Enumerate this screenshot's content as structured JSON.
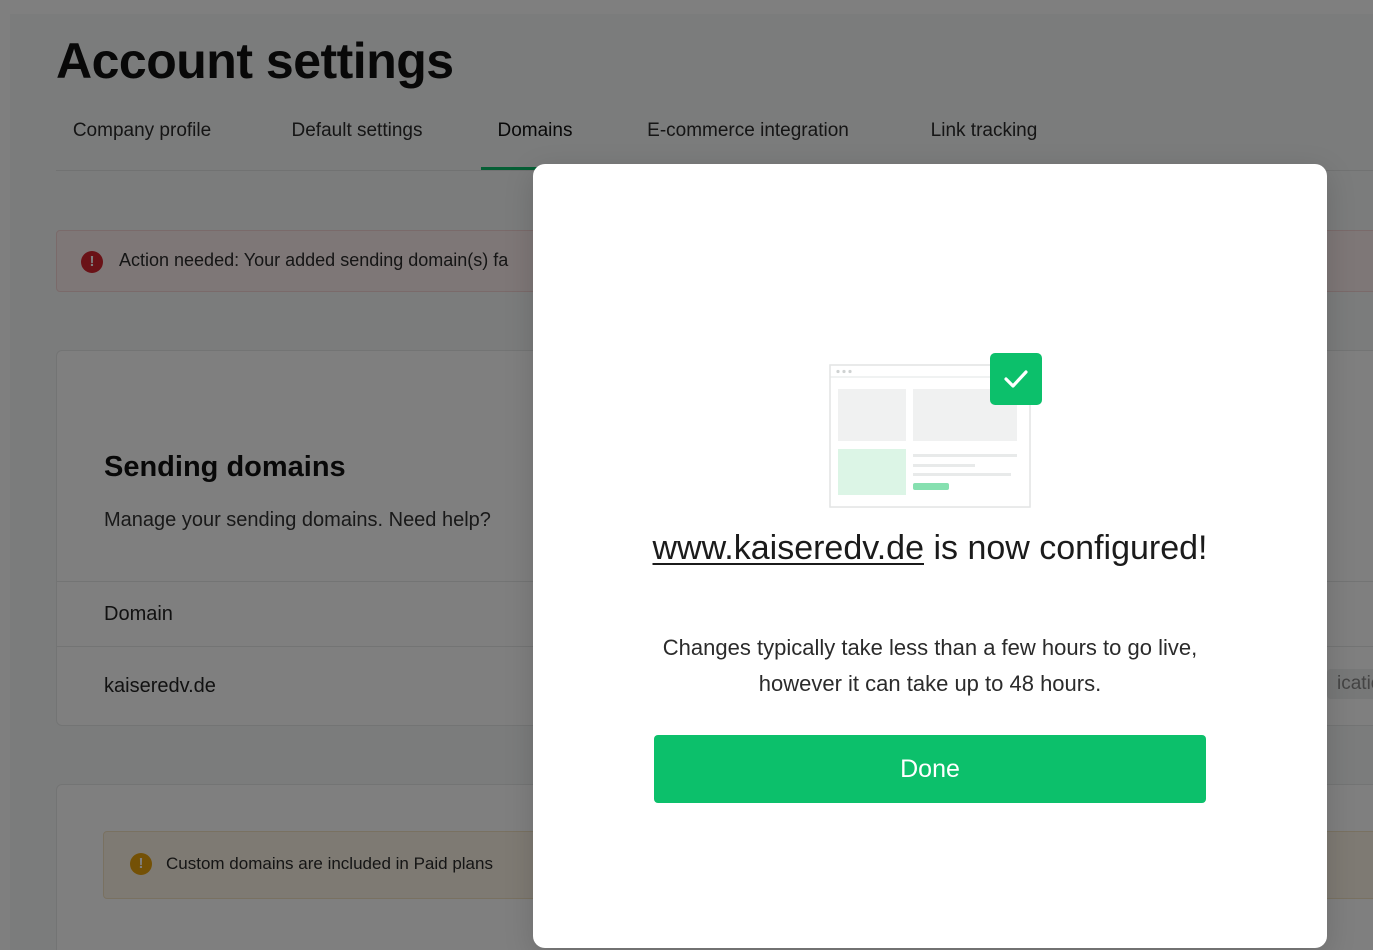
{
  "page": {
    "title": "Account settings",
    "tabs": [
      {
        "label": "Company profile"
      },
      {
        "label": "Default settings"
      },
      {
        "label": "Domains"
      },
      {
        "label": "E-commerce integration"
      },
      {
        "label": "Link tracking"
      }
    ],
    "active_tab": "Domains"
  },
  "alert_error": {
    "icon": "exclamation-circle-icon",
    "text": "Action needed: Your added sending domain(s) fa"
  },
  "sending_domains": {
    "title": "Sending domains",
    "description": "Manage your sending domains. Need help?",
    "column_header": "Domain",
    "rows": [
      {
        "domain": "kaiseredv.de",
        "status": "icatio"
      }
    ]
  },
  "alert_warning": {
    "icon": "exclamation-circle-icon",
    "text": "Custom domains are included in Paid plans"
  },
  "modal": {
    "illustration": "browser-window-with-check-icon",
    "domain_link": "www.kaiseredv.de",
    "title_rest": " is now configured!",
    "description": "Changes typically take less than a few hours to go live, however it can take up to 48 hours.",
    "done_label": "Done"
  },
  "colors": {
    "accent_green": "#0cc06b",
    "error_red": "#d4242e",
    "warning_orange": "#e8a20c",
    "overlay": "rgba(0,0,0,0.5)"
  }
}
